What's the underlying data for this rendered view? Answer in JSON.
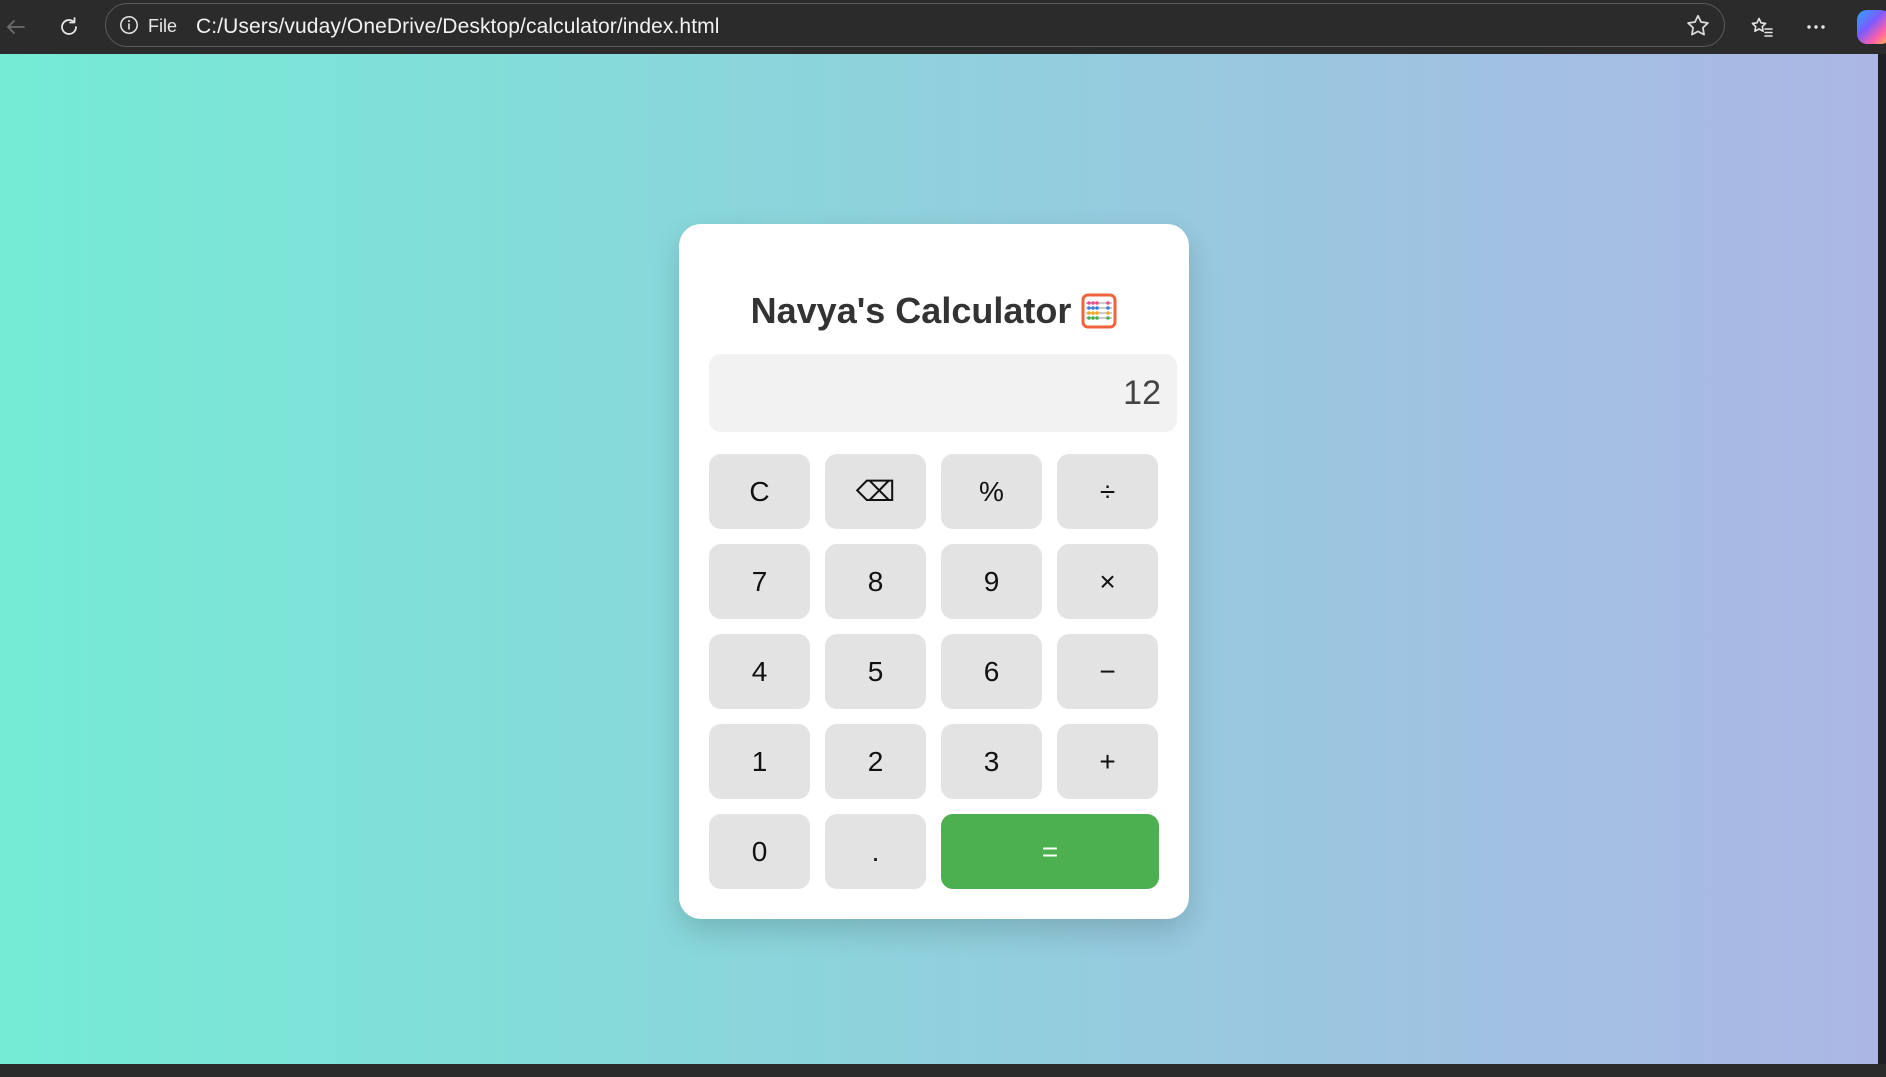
{
  "browser": {
    "back_icon": "arrow-left-icon",
    "reload_icon": "refresh-icon",
    "site_info_icon": "info-icon",
    "scheme_label": "File",
    "url": "C:/Users/vuday/OneDrive/Desktop/calculator/index.html",
    "favorite_icon": "star-icon",
    "favorites_icon": "favorites-list-icon",
    "menu_icon": "more-icon",
    "copilot_icon": "copilot-icon"
  },
  "page": {
    "background_gradient": [
      "#74ebd5",
      "#acb6e5"
    ]
  },
  "calculator": {
    "title": "Navya's Calculator",
    "title_icon": "abacus-icon",
    "display_value": "12",
    "accent_color": "#4caf50",
    "keys": {
      "clear": "C",
      "backspace": "⌫",
      "percent": "%",
      "divide": "÷",
      "seven": "7",
      "eight": "8",
      "nine": "9",
      "multiply": "×",
      "four": "4",
      "five": "5",
      "six": "6",
      "subtract": "−",
      "one": "1",
      "two": "2",
      "three": "3",
      "add": "+",
      "zero": "0",
      "decimal": ".",
      "equals": "="
    }
  }
}
